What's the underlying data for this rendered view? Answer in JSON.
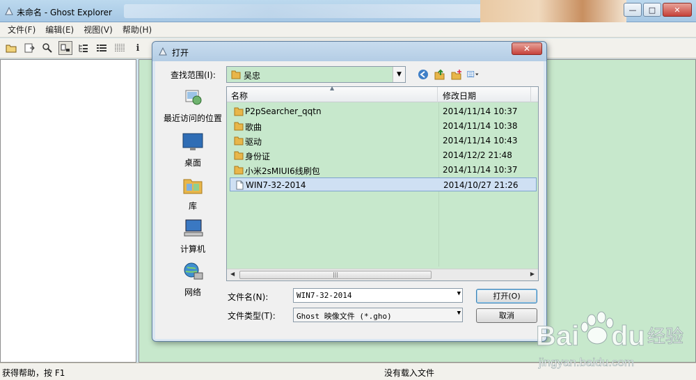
{
  "window": {
    "title": "未命名 - Ghost Explorer",
    "buttons": {
      "minimize": "—",
      "maximize": "□",
      "close": "✕"
    }
  },
  "menu": [
    "文件(F)",
    "编辑(E)",
    "视图(V)",
    "帮助(H)"
  ],
  "toolbar": {
    "icons": [
      "open-icon",
      "extract-icon",
      "find-icon",
      "view-large-icon",
      "view-tree-icon",
      "view-list-icon",
      "view-details-icon",
      "info-icon"
    ]
  },
  "status": {
    "help": "获得帮助，按 F1",
    "state": "没有载入文件"
  },
  "dialog": {
    "title": "打开",
    "close": "✕",
    "look_in_label": "查找范围(I):",
    "look_in_value": "吴忠",
    "places": [
      "最近访问的位置",
      "桌面",
      "库",
      "计算机",
      "网络"
    ],
    "columns": {
      "name": "名称",
      "date": "修改日期"
    },
    "files": [
      {
        "name": "P2pSearcher_qqtn",
        "date": "2014/11/14 10:37",
        "type": "folder"
      },
      {
        "name": "歌曲",
        "date": "2014/11/14 10:38",
        "type": "folder"
      },
      {
        "name": "驱动",
        "date": "2014/11/14 10:43",
        "type": "folder"
      },
      {
        "name": "身份证",
        "date": "2014/12/2 21:48",
        "type": "folder"
      },
      {
        "name": "小米2sMIUI6线刷包",
        "date": "2014/11/14 10:37",
        "type": "folder"
      },
      {
        "name": "WIN7-32-2014",
        "date": "2014/10/27 21:26",
        "type": "file",
        "selected": true
      }
    ],
    "filename_label": "文件名(N):",
    "filename_value": "WIN7-32-2014",
    "filetype_label": "文件类型(T):",
    "filetype_value": "Ghost 映像文件 (*.gho)",
    "open_button": "打开(O)",
    "cancel_button": "取消"
  },
  "watermark": {
    "brand": "Baidu经验",
    "url": "jingyan.baidu.com"
  },
  "colors": {
    "list_bg": "#c7e8cc",
    "selection": "#cfe0f3",
    "folder": "#e8b64a"
  }
}
